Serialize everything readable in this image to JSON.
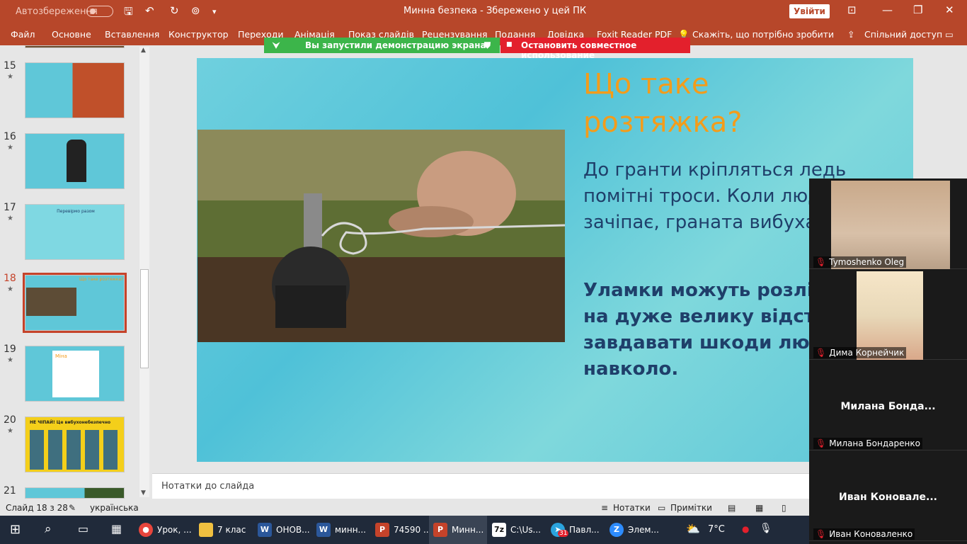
{
  "titlebar": {
    "autosave_label": "Автозбереження",
    "title": "Минна безпека  -  Збережено у цей ПК",
    "signin": "Увійти"
  },
  "ribbon": {
    "tabs": [
      "Файл",
      "Основне",
      "Вставлення",
      "Конструктор",
      "Переходи",
      "Анімація",
      "Показ слайдів",
      "Рецензування",
      "Подання",
      "Довідка",
      "Foxit Reader PDF"
    ],
    "tell_me": "Скажіть, що потрібно зробити",
    "share": "Спільний доступ"
  },
  "sharing": {
    "active": "Вы запустили демонстрацию экрана",
    "stop": "Остановить совместное использование"
  },
  "thumbnails": [
    {
      "number": "15",
      "caption": ""
    },
    {
      "number": "16",
      "caption": ""
    },
    {
      "number": "17",
      "caption": "Перевірмо разом"
    },
    {
      "number": "18",
      "caption": "Що таке розтяжка?"
    },
    {
      "number": "19",
      "caption": "Міна"
    },
    {
      "number": "20",
      "caption": "НЕ ЧІПАЙ! Це вибухонебезпечно"
    },
    {
      "number": "21",
      "caption": ""
    }
  ],
  "slide": {
    "title_line1": "Що таке",
    "title_line2": "розтяжка?",
    "para1": "До гранти кріпляться ледь помітні троси. Коли людина їх зачіпає, граната вибухає.",
    "para2": "Уламки можуть розлітатися на дуже велику відстань і завдавати шкоди людям навколо."
  },
  "notes": {
    "placeholder": "Нотатки до слайда"
  },
  "statusbar": {
    "slide_info": "Слайд 18 з 28",
    "language": "українська",
    "notes_btn": "Нотатки",
    "comments_btn": "Примітки"
  },
  "video": [
    {
      "name": "Tymoshenko Oleg",
      "big": ""
    },
    {
      "name": "Дима Корнейчик",
      "big": ""
    },
    {
      "name": "Милана Бондаренко",
      "big": "Милана  Бонда..."
    },
    {
      "name": "Иван Коноваленко",
      "big": "Иван  Коновале..."
    }
  ],
  "taskbar": {
    "items": [
      {
        "label": "Урок, ...",
        "icon": "chrome-icon",
        "color": "#e8453c"
      },
      {
        "label": "7 клас",
        "icon": "folder-icon",
        "color": "#f0c040"
      },
      {
        "label": "ОНОВ...",
        "icon": "word-icon",
        "color": "#2b579a"
      },
      {
        "label": "минн...",
        "icon": "word-icon",
        "color": "#2b579a"
      },
      {
        "label": "74590 ...",
        "icon": "powerpoint-icon",
        "color": "#c5432a"
      },
      {
        "label": "Минн...",
        "icon": "powerpoint-icon",
        "color": "#c5432a"
      },
      {
        "label": "C:\\Us...",
        "icon": "7zip-icon",
        "color": "#111111"
      },
      {
        "label": "Павл...",
        "icon": "telegram-icon",
        "color": "#2aa3dd"
      },
      {
        "label": "Элем...",
        "icon": "zoom-icon",
        "color": "#2d8cff"
      }
    ],
    "weather": "7°C",
    "telegram_badge": "31"
  }
}
